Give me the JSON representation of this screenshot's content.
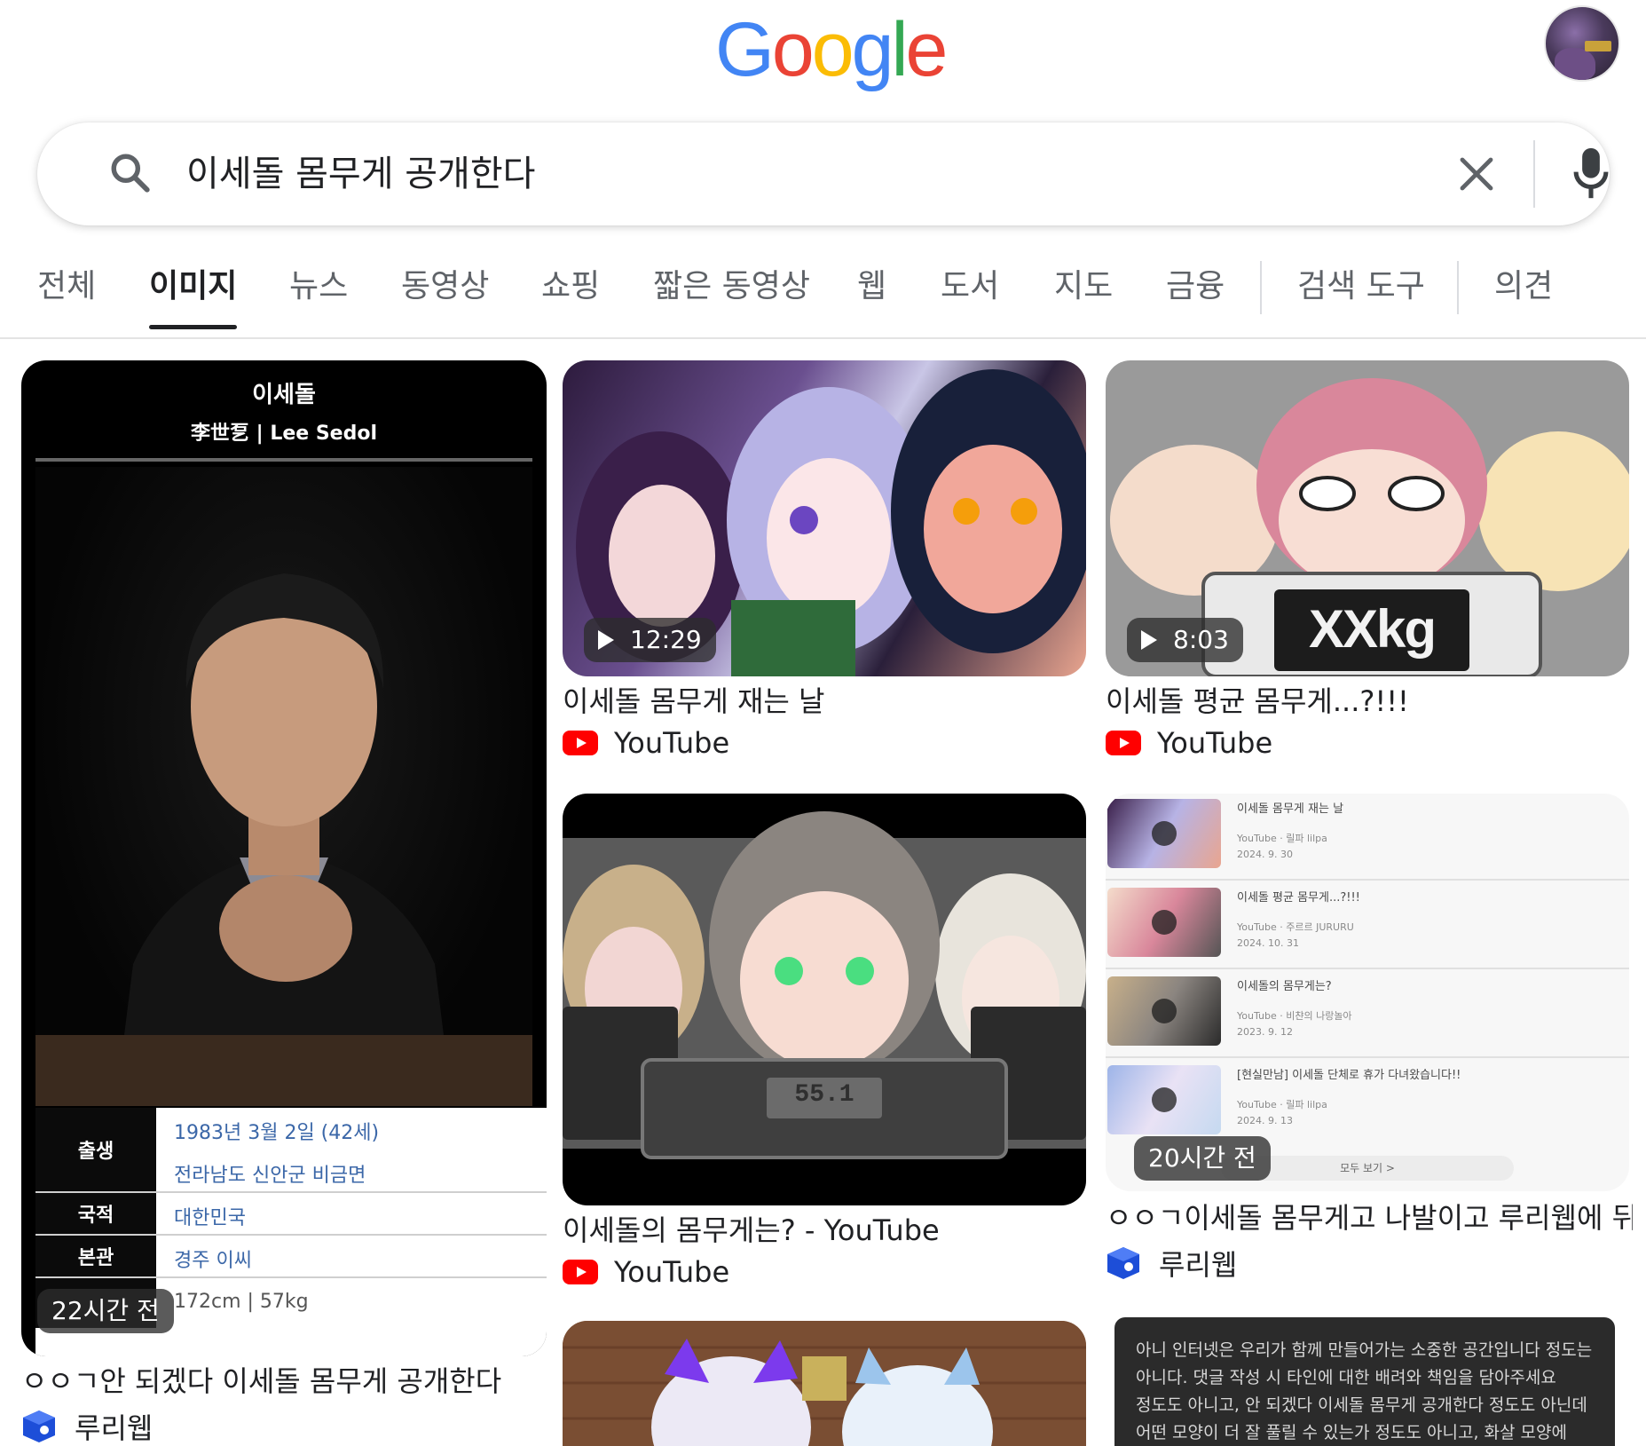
{
  "header": {
    "logo_letters": [
      {
        "ch": "G",
        "color": "#4285F4"
      },
      {
        "ch": "o",
        "color": "#EA4335"
      },
      {
        "ch": "o",
        "color": "#FBBC05"
      },
      {
        "ch": "g",
        "color": "#4285F4"
      },
      {
        "ch": "l",
        "color": "#34A853"
      },
      {
        "ch": "e",
        "color": "#EA4335"
      }
    ]
  },
  "search": {
    "query": "이세돌 몸무게 공개한다"
  },
  "tabs": [
    {
      "label": "전체"
    },
    {
      "label": "이미지"
    },
    {
      "label": "뉴스"
    },
    {
      "label": "동영상"
    },
    {
      "label": "쇼핑"
    },
    {
      "label": "짧은 동영상"
    },
    {
      "label": "웹"
    },
    {
      "label": "도서"
    },
    {
      "label": "지도"
    },
    {
      "label": "금융"
    },
    {
      "label": "검색 도구"
    },
    {
      "label": "의견"
    }
  ],
  "results": [
    {
      "caption": "ㅇㅇㄱ안 되겠다 이세돌 몸무게 공개한다",
      "source": "루리웹",
      "badge": "22시간 전",
      "image_text": {
        "name": "이세돌",
        "sub": "李世乭 | Lee Sedol",
        "rows": [
          {
            "label": "출생",
            "values": [
              "1983년 3월 2일 (42세)",
              "전라남도 신안군 비금면"
            ]
          },
          {
            "label": "국적",
            "values": [
              "대한민국"
            ]
          },
          {
            "label": "본관",
            "values": [
              "경주 이씨"
            ]
          },
          {
            "label": "",
            "values": [
              "172cm | 57kg"
            ]
          }
        ]
      }
    },
    {
      "caption": "이세돌 몸무게 재는 날",
      "source": "YouTube",
      "badge": "12:29"
    },
    {
      "caption": "이세돌 평균 몸무게...?!!!",
      "source": "YouTube",
      "badge": "8:03",
      "image_text": {
        "sign": "XXkg"
      }
    },
    {
      "caption": "이세돌의 몸무게는? - YouTube",
      "source": "YouTube",
      "image_text": {
        "scale": "55.1"
      }
    },
    {
      "caption": "ㅇㅇㄱ이세돌 몸무게고 나발이고 루리웹에 뒤...",
      "source": "루리웹",
      "badge": "20시간 전",
      "image_text": {
        "items": [
          {
            "title": "이세돌 몸무게 재는 날",
            "channel": "YouTube · 릴파 lilpa",
            "date": "2024. 9. 30"
          },
          {
            "title": "이세돌 평균 몸무게...?!!!",
            "channel": "YouTube · 주르르 JURURU",
            "date": "2024. 10. 31"
          },
          {
            "title": "이세돌의 몸무게는?",
            "channel": "YouTube · 비챤의 나랑놀아",
            "date": "2023. 9. 12"
          },
          {
            "title": "[현실만남] 이세돌 단체로 휴가 다녀왔습니다!!",
            "channel": "YouTube · 릴파 lilpa",
            "date": "2024. 9. 13"
          }
        ],
        "more": "모두 보기 >"
      }
    },
    {
      "image_text": {
        "paragraph": "아니 인터넷은 우리가 함께 만들어가는 소중한 공간입니다 정도는 아니다. 댓글 작성 시 타인에 대한 배려와 책임을 담아주세요 정도도 아니고, 안 되겠다 이세돌 몸무게 공개한다 정도도 아닌데 어떤 모양이 더 잘 풀릴 수 있는가 정도도 아니고, 화살 모양에"
      }
    }
  ]
}
